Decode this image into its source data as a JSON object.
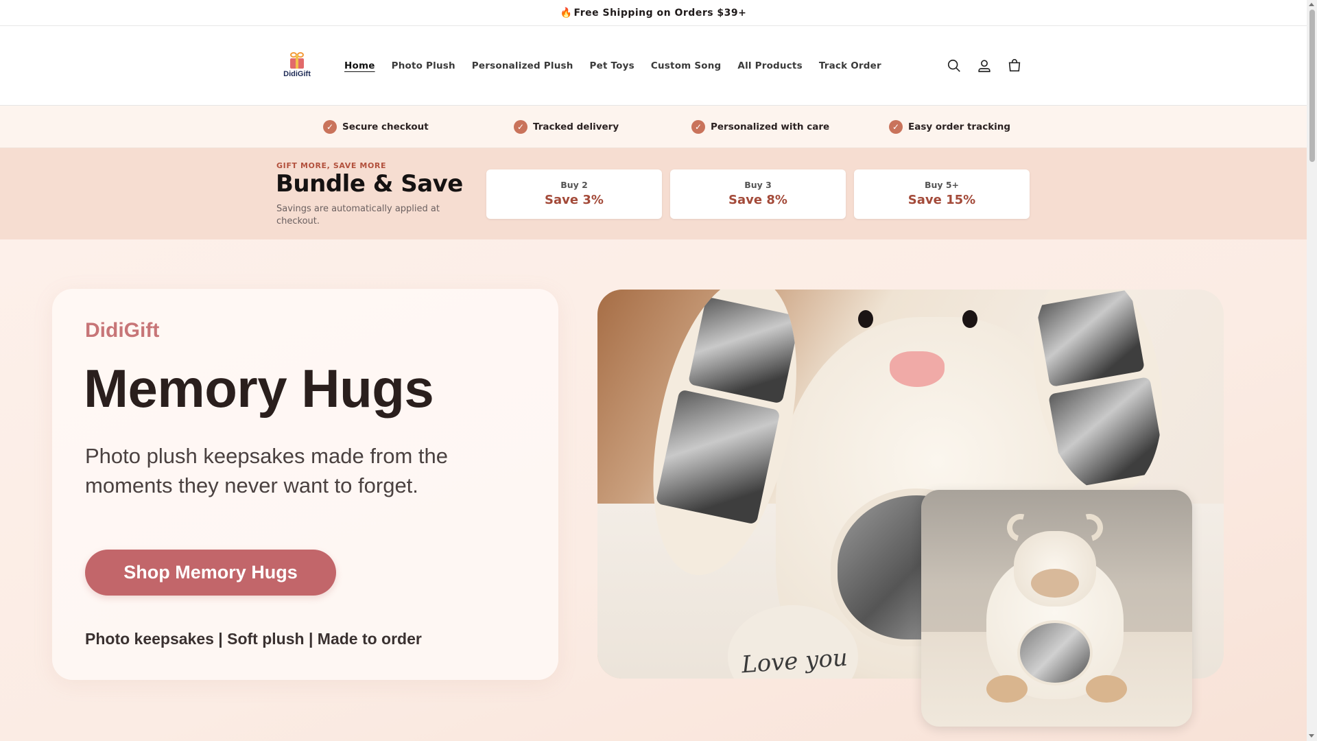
{
  "announcement": {
    "icon": "fire-icon",
    "text": "Free Shipping on Orders $39+"
  },
  "header": {
    "logo_text": "DidiGift",
    "nav": [
      {
        "label": "Home",
        "active": true
      },
      {
        "label": "Photo Plush"
      },
      {
        "label": "Personalized Plush"
      },
      {
        "label": "Pet Toys"
      },
      {
        "label": "Custom Song"
      },
      {
        "label": "All Products"
      },
      {
        "label": "Track Order"
      }
    ],
    "icons": [
      "search-icon",
      "account-icon",
      "cart-icon"
    ]
  },
  "trust": [
    {
      "label": "Secure checkout"
    },
    {
      "label": "Tracked delivery"
    },
    {
      "label": "Personalized with care"
    },
    {
      "label": "Easy order tracking"
    }
  ],
  "bundle": {
    "eyebrow": "GIFT MORE, SAVE MORE",
    "title": "Bundle & Save",
    "subtitle": "Savings are automatically applied at checkout.",
    "tiers": [
      {
        "label": "Buy 2",
        "save": "Save 3%"
      },
      {
        "label": "Buy 3",
        "save": "Save 8%"
      },
      {
        "label": "Buy 5+",
        "save": "Save 15%"
      }
    ]
  },
  "hero": {
    "brand": "DidiGift",
    "title": "Memory Hugs",
    "description": "Photo plush keepsakes made from the moments they never want to forget.",
    "cta": "Shop Memory Hugs",
    "tagline": "Photo keepsakes | Soft plush | Made to order",
    "image_text": "Love you"
  },
  "colors": {
    "accent": "#c2666a",
    "brand": "#c77577",
    "check": "#c9735b",
    "save": "#a34a39"
  }
}
